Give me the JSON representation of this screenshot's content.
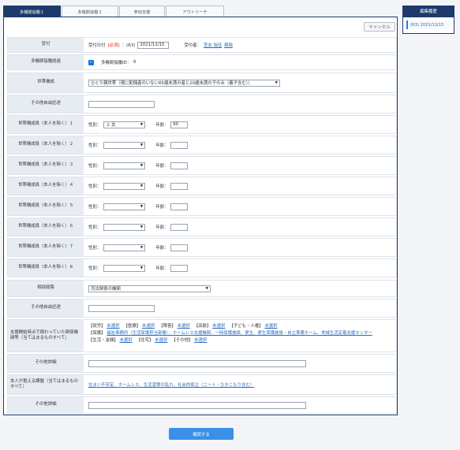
{
  "tabs": [
    "多機関協働１",
    "多機関協働２",
    "参加支援",
    "アウトリーチ"
  ],
  "cancel_label": "キャンセル",
  "side": {
    "title": "編集履歴",
    "entry": "(R3) 2021/12/15"
  },
  "reception": {
    "label": "受付",
    "date_label": "受付日付",
    "required": "[必須]",
    "era": "：(R3)",
    "date_value": "2021/12/15",
    "person_label": "受付者：",
    "person_name": "宮友 瑞佳",
    "clear": "解除"
  },
  "meeting": {
    "label": "多機関協働経過",
    "checkbox_label": "多機関協働ID：",
    "id_value": "6"
  },
  "household": {
    "label": "世帯構成",
    "value": "ひとり親世帯（現に配偶者のいない65歳未満の者と20歳未満の子のみ（養子含む））"
  },
  "other_free": {
    "label": "その他自由記述",
    "value": ""
  },
  "members": [
    {
      "label": "世帯構成員（本人を除く）１",
      "gender_label": "性別：",
      "gender": "２.女",
      "age_label": "年齢：",
      "age": "60"
    },
    {
      "label": "世帯構成員（本人を除く）２",
      "gender_label": "性別：",
      "gender": "",
      "age_label": "年齢：",
      "age": ""
    },
    {
      "label": "世帯構成員（本人を除く）３",
      "gender_label": "性別：",
      "gender": "",
      "age_label": "年齢：",
      "age": ""
    },
    {
      "label": "世帯構成員（本人を除く）４",
      "gender_label": "性別：",
      "gender": "",
      "age_label": "年齢：",
      "age": ""
    },
    {
      "label": "世帯構成員（本人を除く）５",
      "gender_label": "性別：",
      "gender": "",
      "age_label": "年齢：",
      "age": ""
    },
    {
      "label": "世帯構成員（本人を除く）６",
      "gender_label": "性別：",
      "gender": "",
      "age_label": "年齢：",
      "age": ""
    },
    {
      "label": "世帯構成員（本人を除く）７",
      "gender_label": "性別：",
      "gender": "",
      "age_label": "年齢：",
      "age": ""
    },
    {
      "label": "世帯構成員（本人を除く）８",
      "gender_label": "性別：",
      "gender": "",
      "age_label": "年齢：",
      "age": ""
    }
  ],
  "route": {
    "label": "相談経路",
    "value": "司法関係の機関"
  },
  "other_free2": {
    "label": "その他自由記述",
    "value": ""
  },
  "agencies": {
    "label": "支援開始時点で関わっていた関係機関等（当てはまるものすべて）",
    "line1": [
      {
        "cat": "【就労】",
        "link": "未選択"
      },
      {
        "cat": "【医療】",
        "link": "未選択"
      },
      {
        "cat": "【障害】",
        "link": "未選択"
      },
      {
        "cat": "【高齢】",
        "link": "未選択"
      },
      {
        "cat": "【子ども・人権】",
        "link": "未選択"
      }
    ],
    "line2_cat": "【保護】",
    "line2_link": "福祉事務所（生活保護担当部署）、ホームレス支援機関、一時保護施設、更生、更生保護施設・自立準備ホーム、地域生活定着支援センター",
    "line3": [
      {
        "cat": "【生活・金銭】",
        "link": "未選択"
      },
      {
        "cat": "【住宅】",
        "link": "未選択"
      },
      {
        "cat": "【その他】",
        "link": "未選択"
      }
    ]
  },
  "other_detail1": {
    "label": "その他詳細",
    "value": ""
  },
  "issues": {
    "label": "本人が抱える課題（当てはまるものすべて）",
    "value": "住まい不安定、ホームレス、生活習慣の乱れ、社会的孤立（ニート・ひきこもり含む）"
  },
  "other_detail2": {
    "label": "その他詳細",
    "value": ""
  },
  "confirm_label": "確認する"
}
